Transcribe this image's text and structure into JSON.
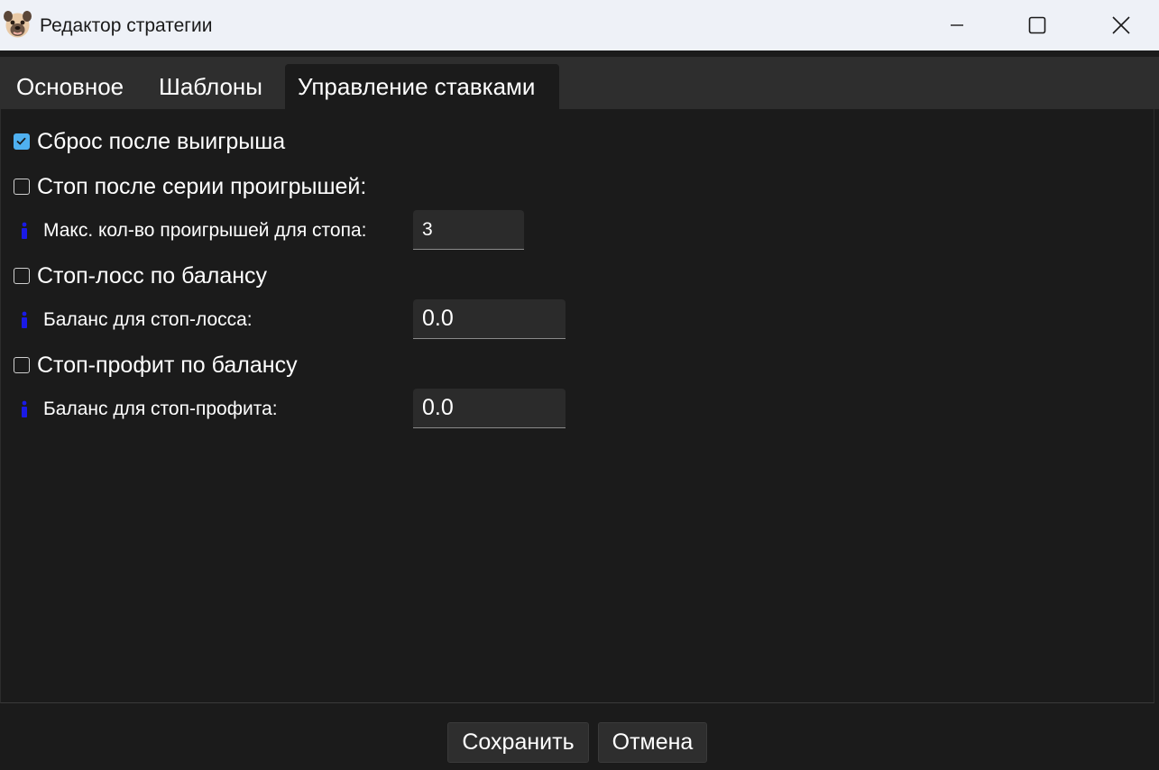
{
  "window": {
    "title": "Редактор стратегии",
    "icon": "pug-face-icon"
  },
  "tabs": [
    {
      "label": "Основное",
      "active": false
    },
    {
      "label": "Шаблоны",
      "active": false
    },
    {
      "label": "Управление ставками",
      "active": true
    }
  ],
  "settings": {
    "reset_after_win": {
      "label": "Сброс после выигрыша",
      "checked": true
    },
    "stop_after_losses": {
      "label": "Стоп после серии проигрышей:",
      "checked": false
    },
    "max_losses": {
      "label": "Макс. кол-во проигрышей для стопа:",
      "value": "3"
    },
    "stop_loss": {
      "label": "Стоп-лосс по балансу",
      "checked": false
    },
    "stop_loss_balance": {
      "label": "Баланс для стоп-лосса:",
      "value": "0.0"
    },
    "stop_profit": {
      "label": "Стоп-профит по балансу",
      "checked": false
    },
    "stop_profit_balance": {
      "label": "Баланс для стоп-профита:",
      "value": "0.0"
    }
  },
  "footer": {
    "save_label": "Сохранить",
    "cancel_label": "Отмена"
  },
  "colors": {
    "background": "#1b1b1b",
    "tabbar": "#2e2e2e",
    "titlebar": "#eef1f7",
    "checkbox_accent": "#4fb0f0",
    "info_icon": "#1a1ae6"
  }
}
